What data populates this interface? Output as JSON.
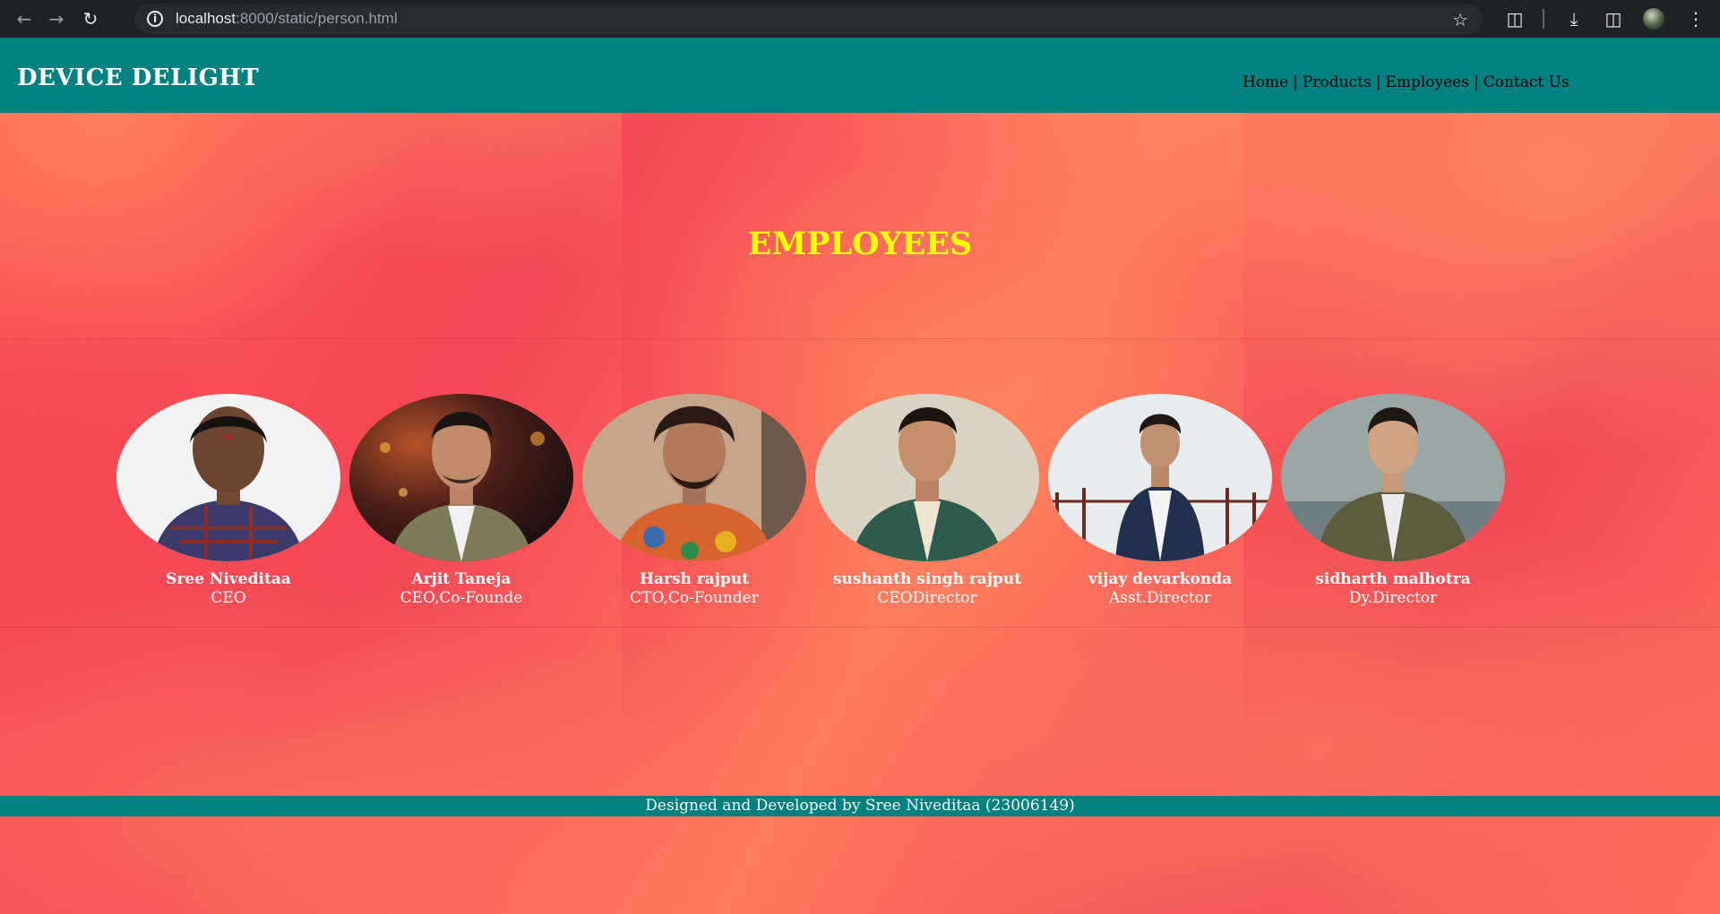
{
  "browser": {
    "url_host": "localhost",
    "url_rest": ":8000/static/person.html"
  },
  "header": {
    "brand": "DEVICE DELIGHT",
    "nav": [
      {
        "label": "Home"
      },
      {
        "label": "Products"
      },
      {
        "label": "Employees"
      },
      {
        "label": "Contact Us"
      }
    ],
    "separator": "|"
  },
  "main": {
    "title": "EMPLOYEES",
    "employees": [
      {
        "name": "Sree Niveditaa",
        "role": "CEO"
      },
      {
        "name": "Arjit Taneja",
        "role": "CEO,Co-Founde"
      },
      {
        "name": "Harsh rajput",
        "role": "CTO,Co-Founder"
      },
      {
        "name": "sushanth singh rajput",
        "role": "CEODirector"
      },
      {
        "name": "vijay devarkonda",
        "role": "Asst.Director"
      },
      {
        "name": "sidharth malhotra",
        "role": "Dy.Director"
      }
    ]
  },
  "footer": {
    "text": "Designed and Developed by Sree Niveditaa (23006149)"
  },
  "colors": {
    "header_bg": "#038080",
    "title": "#ffff00",
    "page_bg": "#f4544f"
  },
  "icons": [
    "back-icon",
    "forward-icon",
    "reload-icon",
    "site-info-icon",
    "bookmark-star-icon",
    "extensions-icon",
    "download-icon",
    "side-panel-icon",
    "profile-avatar",
    "menu-icon"
  ]
}
